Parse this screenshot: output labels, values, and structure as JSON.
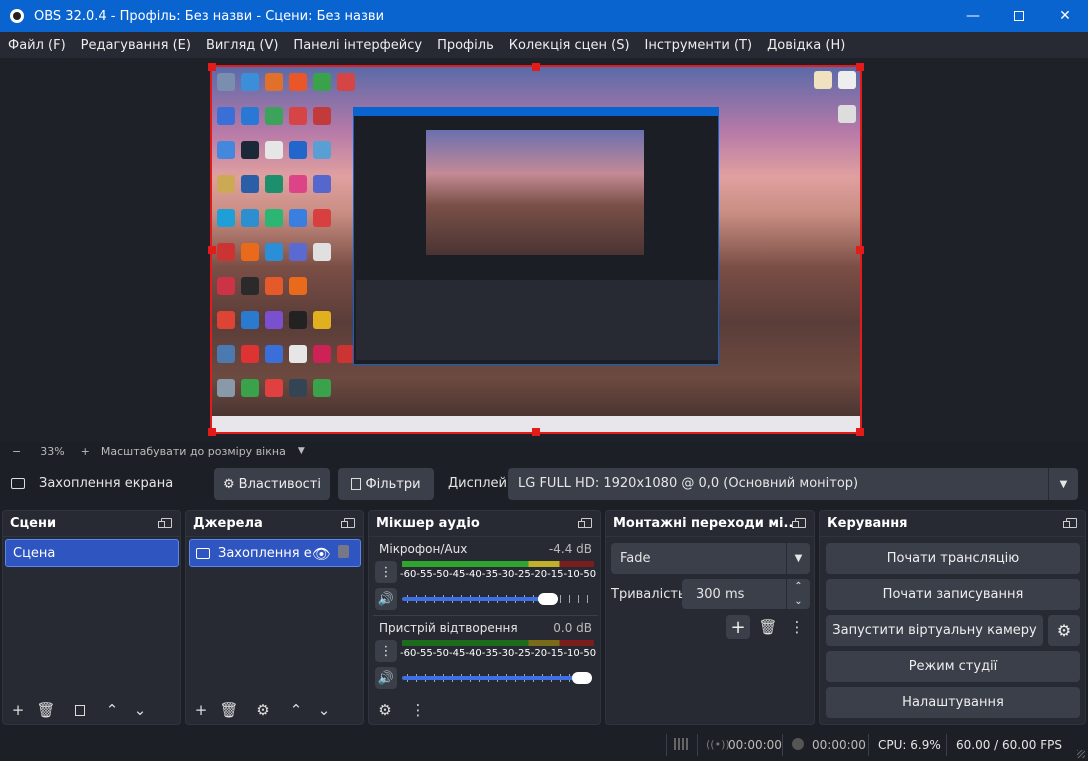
{
  "window": {
    "title": "OBS 32.0.4 - Профіль: Без назви - Сцени: Без назви",
    "minimize_icon": "minimize-icon",
    "maximize_icon": "maximize-icon",
    "close_icon": "close-icon"
  },
  "menu": {
    "items": [
      "Файл (F)",
      "Редагування (E)",
      "Вигляд (V)",
      "Панелі інтерфейсу",
      "Профіль",
      "Колекція сцен (S)",
      "Інструменти (T)",
      "Довідка (H)"
    ]
  },
  "zoom": {
    "minus": "−",
    "level": "33%",
    "plus": "+",
    "fit_label": "Масштабувати до розміру вікна"
  },
  "source_toolbar": {
    "source_name": "Захоплення екрана",
    "properties_label": "Властивості",
    "filters_label": "Фільтри",
    "display_label": "Дисплей",
    "display_value": "LG FULL HD: 1920x1080 @ 0,0 (Основний монітор)"
  },
  "scenes": {
    "title": "Сцени",
    "items": [
      "Сцена"
    ]
  },
  "sources": {
    "title": "Джерела",
    "items": [
      "Захоплення е"
    ]
  },
  "mixer": {
    "title": "Мікшер аудіо",
    "channels": [
      {
        "name": "Мікрофон/Aux",
        "db": "-4.4 dB",
        "level": 0.93,
        "volume": 0.82
      },
      {
        "name": "Пристрій відтворення",
        "db": "0.0 dB",
        "level": 0.0,
        "volume": 1.0
      }
    ],
    "scale": [
      "-60",
      "-55",
      "-50",
      "-45",
      "-40",
      "-35",
      "-30",
      "-25",
      "-20",
      "-15",
      "-10",
      "-5",
      "0"
    ]
  },
  "transitions": {
    "title": "Монтажні переходи мі...",
    "selected": "Fade",
    "duration_label": "Тривалість",
    "duration_value": "300 ms"
  },
  "controls": {
    "title": "Керування",
    "start_stream": "Почати трансляцію",
    "start_record": "Почати записування",
    "virtual_cam": "Запустити віртуальну камеру",
    "studio_mode": "Режим студії",
    "settings": "Налаштування"
  },
  "status": {
    "stream_time": "00:00:00",
    "record_time": "00:00:00",
    "cpu": "CPU: 6.9%",
    "fps": "60.00 / 60.00 FPS"
  },
  "colors": {
    "accent": "#0a64d0",
    "selection": "#2f55c0",
    "bounding_box": "#e41b1b"
  }
}
